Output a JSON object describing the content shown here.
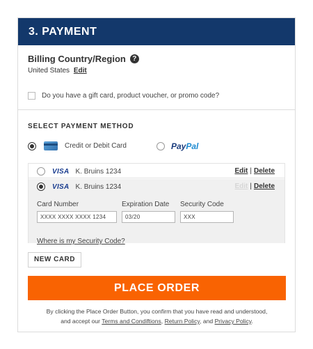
{
  "header": {
    "title": "3. PAYMENT"
  },
  "billing": {
    "title": "Billing Country/Region",
    "help_icon": "question-circle-icon",
    "country": "United States",
    "edit_label": "Edit"
  },
  "gift": {
    "label": "Do you have a gift card, product voucher, or promo code?",
    "checked": false
  },
  "payment_method": {
    "title": "SELECT PAYMENT METHOD",
    "options": [
      {
        "label": "Credit or Debit Card",
        "icon": "credit-card-icon",
        "selected": true
      },
      {
        "label_pay": "Pay",
        "label_pal": "Pal",
        "icon": "paypal-logo",
        "selected": false
      }
    ]
  },
  "cards": [
    {
      "brand": "VISA",
      "name": "K. Bruins 1234",
      "edit_label": "Edit",
      "delete_label": "Delete",
      "selected": false,
      "separator": "|"
    },
    {
      "brand": "VISA",
      "name": "K. Bruins 1234",
      "edit_label": "Edit",
      "delete_label": "Delete",
      "selected": true,
      "separator": "|"
    }
  ],
  "card_form": {
    "card_number_label": "Card Number",
    "card_number_value": "XXXX XXXX XXXX 1234",
    "expiration_label": "Expiration Date",
    "expiration_value": "03/20",
    "security_label": "Security Code",
    "security_value": "XXX",
    "security_help_link": "Where is my Security Code?"
  },
  "buttons": {
    "new_card": "NEW CARD",
    "place_order": "PLACE ORDER"
  },
  "disclaimer": {
    "line1": "By clicking the Place Order Button, you confirm that you have read and understood,",
    "line2_pre": "and accept our ",
    "terms_link": "Terms and Condiftions",
    "comma": ", ",
    "return_link": "Return Policy",
    "and_text": ", and ",
    "privacy_link": "Privacy Policy",
    "period": "."
  },
  "colors": {
    "header_bg": "#13386b",
    "place_order_bg": "#f96302",
    "visa": "#1a3d8f",
    "paypal_pay": "#1b3c7d",
    "paypal_pal": "#1e8bd1"
  }
}
